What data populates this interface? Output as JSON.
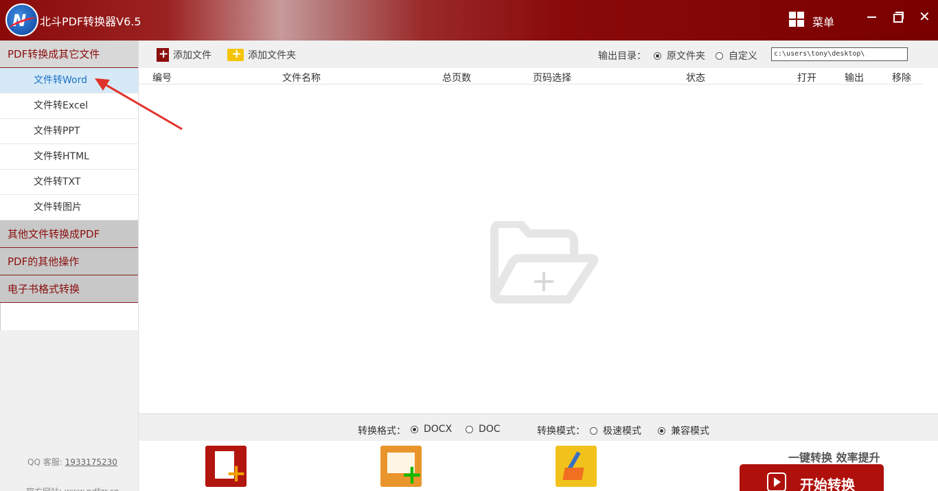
{
  "titlebar": {
    "title": "北斗PDF转换器V6.5",
    "menu_label": "菜单",
    "close_glyph": "✕"
  },
  "sidebar": {
    "categories": [
      {
        "label": "PDF转换成其它文件"
      },
      {
        "label": "其他文件转换成PDF"
      },
      {
        "label": "PDF的其他操作"
      },
      {
        "label": "电子书格式转换"
      }
    ],
    "sub_items": [
      {
        "label": "文件转Word",
        "active": true
      },
      {
        "label": "文件转Excel"
      },
      {
        "label": "文件转PPT"
      },
      {
        "label": "文件转HTML"
      },
      {
        "label": "文件转TXT"
      },
      {
        "label": "文件转图片"
      }
    ],
    "qq_label": "QQ 客服:",
    "qq_number": "1933175230",
    "site_label": "官方网站: www.pdfzr.cn"
  },
  "toolbar": {
    "add_file": "添加文件",
    "add_folder": "添加文件夹",
    "output_label": "输出目录：",
    "output_original": "原文件夹",
    "output_custom": "自定义",
    "output_path": "c:\\users\\tony\\desktop\\"
  },
  "table": {
    "headers": [
      "编号",
      "文件名称",
      "总页数",
      "页码选择",
      "状态",
      "打开",
      "输出",
      "移除"
    ]
  },
  "options": {
    "format_label": "转换格式：",
    "format_docx": "DOCX",
    "format_doc": "DOC",
    "mode_label": "转换模式：",
    "mode_fast": "极速模式",
    "mode_compat": "兼容模式"
  },
  "actions": {
    "slogan": "一键转换  效率提升",
    "start_label": "开始转换"
  },
  "colors": {
    "brand": "#8b0e0e",
    "active_bg": "#d6e9f7",
    "active_text": "#1a73c6"
  }
}
